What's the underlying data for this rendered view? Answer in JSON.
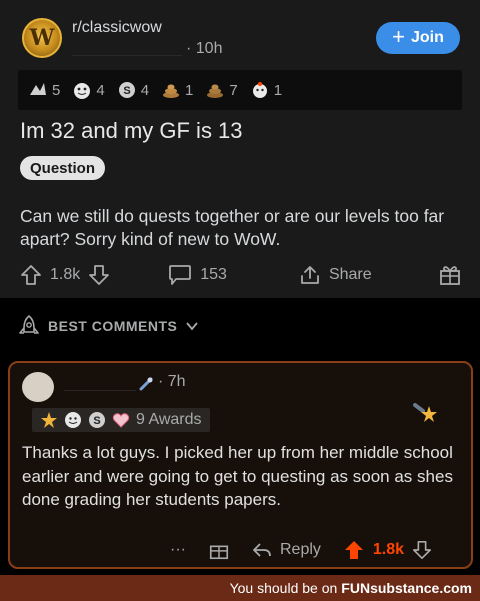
{
  "post": {
    "subreddit": "r/classicwow",
    "time": "· 10h",
    "join_label": "Join",
    "awards": [
      {
        "count": "5",
        "icon": "silver-award-icon",
        "color": "#c8c8c8"
      },
      {
        "count": "4",
        "icon": "wholesome-award-icon",
        "color": "#e8e8e8"
      },
      {
        "count": "4",
        "icon": "coin-award-icon",
        "color": "#d0d0d0"
      },
      {
        "count": "1",
        "icon": "poop-award-icon",
        "color": "#b07a3a"
      },
      {
        "count": "7",
        "icon": "poop-award-icon",
        "color": "#9a6a30"
      },
      {
        "count": "1",
        "icon": "doge-award-icon",
        "color": "#e8e8e8"
      }
    ],
    "title": "Im 32 and my GF is 13",
    "flair": "Question",
    "body": "Can we still do quests together or are our levels too far apart? Sorry kind of new to WoW.",
    "upvotes": "1.8k",
    "comments": "153",
    "share_label": "Share"
  },
  "sort": {
    "label": "BEST COMMENTS"
  },
  "comment": {
    "time": "· 7h",
    "awards_label": "9 Awards",
    "text": "Thanks a lot guys. I picked her up from her middle school earlier and were going to get to questing as soon as shes done grading her students papers.",
    "more": "···",
    "reply_label": "Reply",
    "upvotes": "1.8k"
  },
  "banner": {
    "prefix": "You should be on",
    "site": "FUNsubstance.com"
  },
  "colors": {
    "accent": "#3b8ee8",
    "upvote": "#ff4500",
    "comment_border": "#8a3e18",
    "banner": "#6a2a16"
  }
}
